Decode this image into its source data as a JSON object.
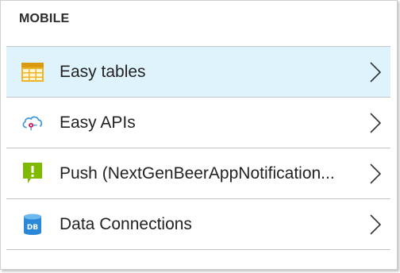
{
  "section": {
    "title": "MOBILE"
  },
  "menu": {
    "items": [
      {
        "label": "Easy tables",
        "icon": "table-icon",
        "selected": true
      },
      {
        "label": "Easy APIs",
        "icon": "cloud-api-icon",
        "selected": false
      },
      {
        "label": "Push (NextGenBeerAppNotification...",
        "icon": "push-notification-icon",
        "selected": false
      },
      {
        "label": "Data Connections",
        "icon": "database-icon",
        "selected": false
      }
    ]
  },
  "colors": {
    "selected_background": "#dff3fd",
    "divider": "#c6c6c6",
    "table_icon": "#f0b429",
    "push_icon": "#7fba00",
    "database_icon": "#2b88d8"
  }
}
